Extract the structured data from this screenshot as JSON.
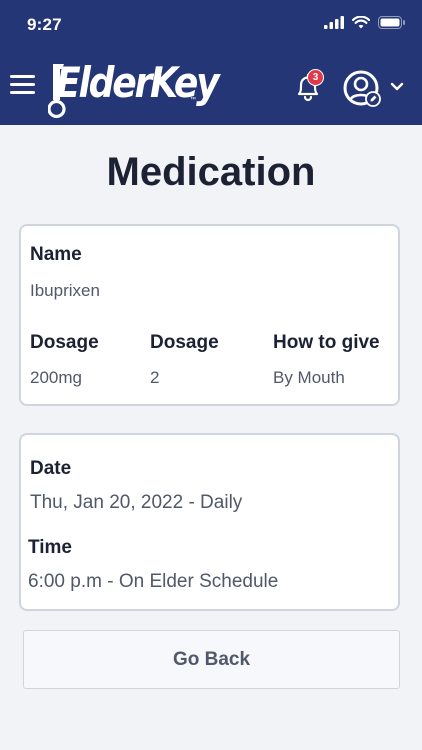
{
  "status_bar": {
    "time": "9:27"
  },
  "header": {
    "logo_text": "ElderKey",
    "logo_tm": "™",
    "notification_count": "3"
  },
  "page": {
    "title": "Medication"
  },
  "medication_card": {
    "name_label": "Name",
    "name_value": "Ibuprixen",
    "dosage_label": "Dosage",
    "dosage_value": "200mg",
    "quantity_label": "Dosage",
    "quantity_value": "2",
    "how_label": "How to give",
    "how_value": "By Mouth"
  },
  "schedule_card": {
    "date_label": "Date",
    "date_value": "Thu, Jan 20, 2022 - Daily",
    "time_label": "Time",
    "time_value": "6:00 p.m - On Elder Schedule"
  },
  "actions": {
    "go_back_label": "Go Back"
  },
  "colors": {
    "header_bg": "#243676",
    "badge": "#e2394a",
    "page_bg": "#f1f3f7"
  }
}
